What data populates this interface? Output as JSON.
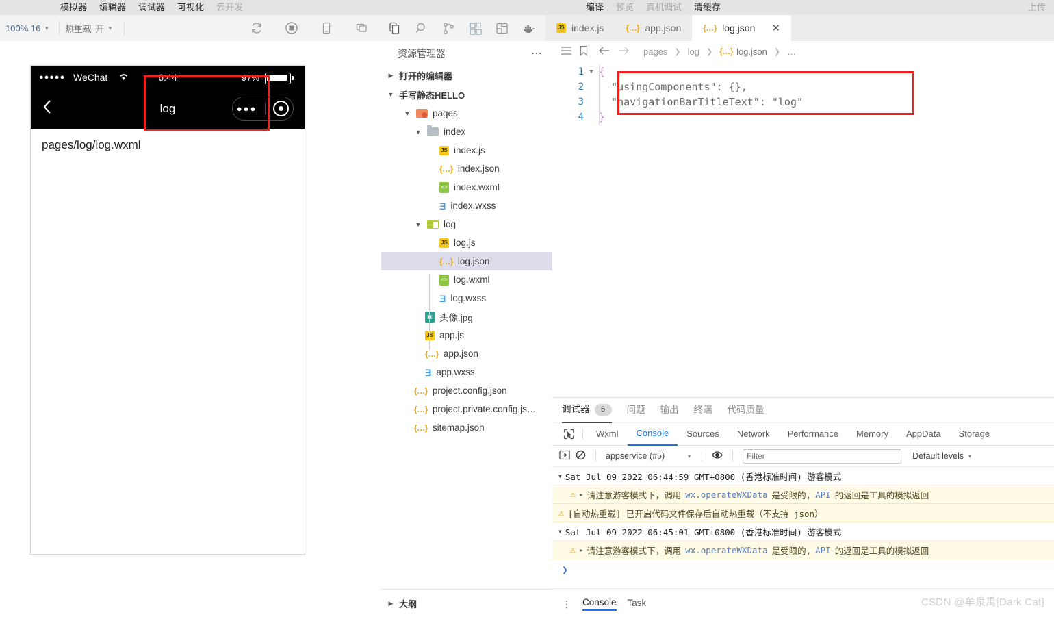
{
  "menubar": {
    "left_items": [
      {
        "label": "模拟器",
        "dim": false
      },
      {
        "label": "编辑器",
        "dim": false
      },
      {
        "label": "调试器",
        "dim": false
      },
      {
        "label": "可视化",
        "dim": false
      },
      {
        "label": "云开发",
        "dim": true
      }
    ],
    "mid_items": [
      {
        "label": "编译",
        "dim": false
      },
      {
        "label": "预览",
        "dim": true
      },
      {
        "label": "真机调试",
        "dim": true
      },
      {
        "label": "清缓存",
        "dim": false
      }
    ],
    "right_items": [
      {
        "label": "上传",
        "dim": true
      }
    ]
  },
  "sim_toolbar": {
    "zoom_label": "100% 16",
    "hotreload_label": "热重载",
    "hotreload_state": "开",
    "icons": [
      "refresh-icon",
      "record-icon",
      "device-icon",
      "multiscreen-icon"
    ]
  },
  "activity_bar": {
    "icons": [
      "files-icon",
      "search-icon",
      "source-control-icon",
      "extensions-icon",
      "layout-icon",
      "docker-icon"
    ]
  },
  "tabs": [
    {
      "label": "index.js",
      "icon": "js-file-icon",
      "active": false,
      "closable": false
    },
    {
      "label": "app.json",
      "icon": "json-file-icon",
      "active": false,
      "closable": false
    },
    {
      "label": "log.json",
      "icon": "json-file-icon",
      "active": true,
      "closable": true
    }
  ],
  "simulator": {
    "status_bar": {
      "signal_dots": "●●●●●",
      "carrier": "WeChat",
      "time": "6:44",
      "battery_percent": "97%"
    },
    "nav_title": "log",
    "capsule_dots": "●●●",
    "page_content": "pages/log/log.wxml",
    "highlight_color": "#ef2020"
  },
  "explorer": {
    "title": "资源管理器",
    "open_editors_label": "打开的编辑器",
    "project_label": "手写静态HELLO",
    "outline_label": "大纲",
    "tree": [
      {
        "label": "pages",
        "type": "folder-pages",
        "depth": 1,
        "expanded": true,
        "selected": false
      },
      {
        "label": "index",
        "type": "folder-gray",
        "depth": 2,
        "expanded": true,
        "selected": false
      },
      {
        "label": "index.js",
        "type": "js",
        "depth": 3,
        "selected": false
      },
      {
        "label": "index.json",
        "type": "json",
        "depth": 3,
        "selected": false
      },
      {
        "label": "index.wxml",
        "type": "wxml",
        "depth": 3,
        "selected": false
      },
      {
        "label": "index.wxss",
        "type": "wxss",
        "depth": 3,
        "selected": false
      },
      {
        "label": "log",
        "type": "folder-log",
        "depth": 2,
        "expanded": true,
        "selected": false
      },
      {
        "label": "log.js",
        "type": "js",
        "depth": 3,
        "selected": false
      },
      {
        "label": "log.json",
        "type": "json",
        "depth": 3,
        "selected": true
      },
      {
        "label": "log.wxml",
        "type": "wxml",
        "depth": 3,
        "selected": false
      },
      {
        "label": "log.wxss",
        "type": "wxss",
        "depth": 3,
        "selected": false
      },
      {
        "label": "头像.jpg",
        "type": "img",
        "depth": 2,
        "selected": false
      },
      {
        "label": "app.js",
        "type": "js",
        "depth": 2,
        "selected": false
      },
      {
        "label": "app.json",
        "type": "json",
        "depth": 2,
        "selected": false
      },
      {
        "label": "app.wxss",
        "type": "wxss",
        "depth": 2,
        "selected": false
      },
      {
        "label": "project.config.json",
        "type": "json",
        "depth": 2,
        "selected": false
      },
      {
        "label": "project.private.config.js…",
        "type": "json",
        "depth": 2,
        "selected": false
      },
      {
        "label": "sitemap.json",
        "type": "json",
        "depth": 2,
        "selected": false
      }
    ]
  },
  "editor": {
    "breadcrumb": [
      "pages",
      "log",
      "log.json",
      "…"
    ],
    "breadcrumb_icons": [
      "list-icon",
      "bookmark-icon",
      "back-arrow-icon",
      "forward-arrow-icon"
    ],
    "lines": [
      {
        "num": "1",
        "foldable": true,
        "text": "{"
      },
      {
        "num": "2",
        "foldable": false,
        "text": "  \"usingComponents\": {},"
      },
      {
        "num": "3",
        "foldable": false,
        "text": "  \"navigationBarTitleText\": \"log\""
      },
      {
        "num": "4",
        "foldable": false,
        "text": "}"
      }
    ],
    "highlight_color": "#ef2020"
  },
  "debugger": {
    "panel_tabs": [
      {
        "label": "调试器",
        "badge": "6",
        "active": true
      },
      {
        "label": "问题",
        "badge": "",
        "active": false
      },
      {
        "label": "输出",
        "badge": "",
        "active": false
      },
      {
        "label": "终端",
        "badge": "",
        "active": false
      },
      {
        "label": "代码质量",
        "badge": "",
        "active": false
      }
    ],
    "devtool_tabs": [
      {
        "label": "Wxml",
        "active": false
      },
      {
        "label": "Console",
        "active": true
      },
      {
        "label": "Sources",
        "active": false
      },
      {
        "label": "Network",
        "active": false
      },
      {
        "label": "Performance",
        "active": false
      },
      {
        "label": "Memory",
        "active": false
      },
      {
        "label": "AppData",
        "active": false
      },
      {
        "label": "Storage",
        "active": false
      }
    ],
    "console_toolbar": {
      "context": "appservice (#5)",
      "filter_placeholder": "Filter",
      "filter_value": "",
      "levels": "Default levels",
      "icons": [
        "sidebar-icon",
        "clear-console-icon",
        "eye-icon"
      ]
    },
    "console_rows": [
      {
        "kind": "group",
        "text": "Sat Jul 09 2022 06:44:59 GMT+0800 (香港标准时间) 游客模式"
      },
      {
        "kind": "warn-indent",
        "prefix": "请注意游客模式下，调用 ",
        "code": "wx.operateWXData",
        "mid": " 是受限的, ",
        "code2": "API",
        "suffix": " 的返回是工具的模拟返回"
      },
      {
        "kind": "warn",
        "text": "[自动热重载] 已开启代码文件保存后自动热重载（不支持 json）"
      },
      {
        "kind": "group",
        "text": "Sat Jul 09 2022 06:45:01 GMT+0800 (香港标准时间) 游客模式"
      },
      {
        "kind": "warn-indent",
        "prefix": "请注意游客模式下，调用 ",
        "code": "wx.operateWXData",
        "mid": " 是受限的, ",
        "code2": "API",
        "suffix": " 的返回是工具的模拟返回"
      },
      {
        "kind": "prompt",
        "text": "❯"
      }
    ],
    "bottom_tabs": [
      {
        "label": "Console",
        "active": true
      },
      {
        "label": "Task",
        "active": false
      }
    ]
  },
  "watermark": "CSDN @牟泉禹[Dark Cat]"
}
